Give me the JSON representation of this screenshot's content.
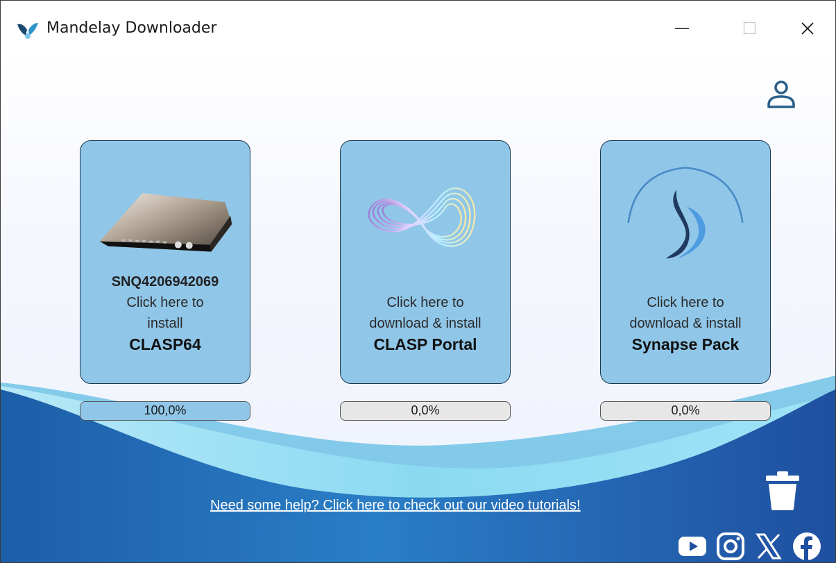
{
  "window": {
    "title": "Mandelay Downloader",
    "controls": [
      "minimize",
      "maximize",
      "close"
    ]
  },
  "header": {
    "profile_icon": "user-profile-icon"
  },
  "cards": [
    {
      "serial": "SNQ4206942069",
      "lines": [
        "Click here to",
        "install"
      ],
      "product": "CLASP64",
      "image": "hardware-device-image",
      "progress": {
        "label": "100,0%",
        "value": 1.0
      }
    },
    {
      "serial": "",
      "lines": [
        "Click here to",
        "download & install"
      ],
      "product": "CLASP Portal",
      "image": "clasp-portal-logo",
      "progress": {
        "label": "0,0%",
        "value": 0.0
      }
    },
    {
      "serial": "",
      "lines": [
        "Click here to",
        "download & install"
      ],
      "product": "Synapse Pack",
      "image": "synapse-logo",
      "progress": {
        "label": "0,0%",
        "value": 0.0
      }
    }
  ],
  "help_link": "Need some help? Click here to check out our video tutorials!",
  "footer": {
    "trash_icon": "trash-icon",
    "social": [
      "youtube-icon",
      "instagram-icon",
      "x-icon",
      "facebook-icon"
    ]
  },
  "colors": {
    "card_bg": "#90c6e8",
    "card_border": "#1e3a4e",
    "wave_dark": "#1d5ea8",
    "wave_light": "#8fd8f0",
    "accent_icon": "#2a5f8a"
  }
}
